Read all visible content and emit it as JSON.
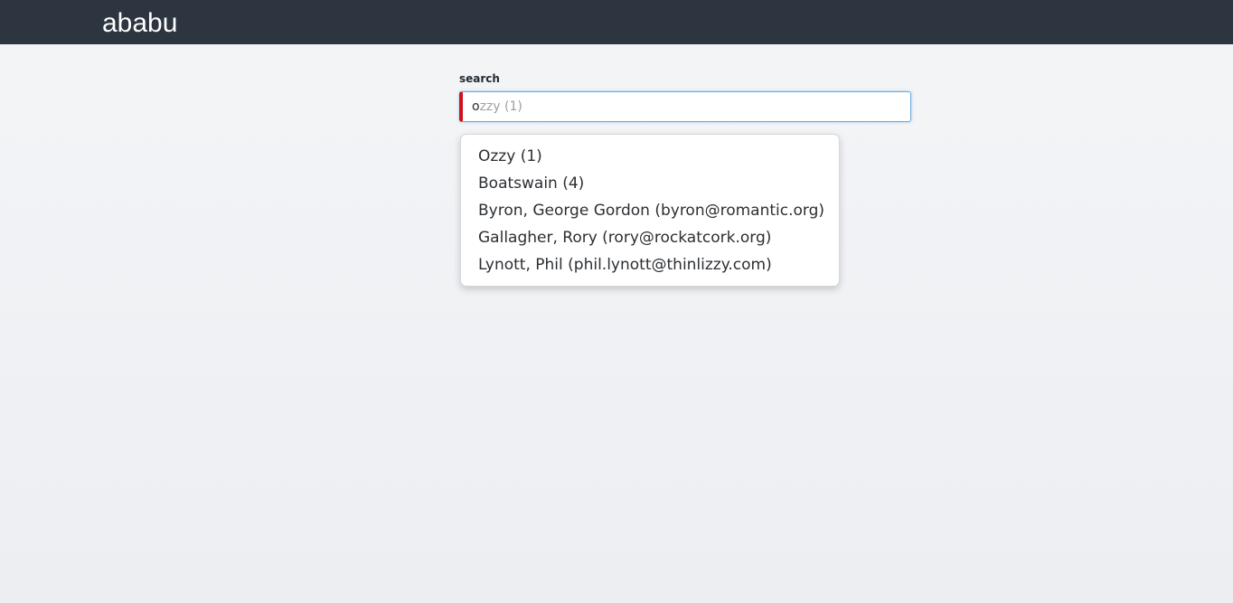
{
  "header": {
    "brand": "ababu"
  },
  "search": {
    "label": "search",
    "value": "o",
    "autocomplete_hint": "ozzy (1)"
  },
  "dropdown": {
    "items": [
      {
        "label": "Ozzy (1)"
      },
      {
        "label": "Boatswain (4)"
      },
      {
        "label": "Byron, George Gordon (byron@romantic.org)"
      },
      {
        "label": "Gallagher, Rory (rory@rockatcork.org)"
      },
      {
        "label": "Lynott, Phil (phil.lynott@thinlizzy.com)"
      }
    ]
  },
  "colors": {
    "header_bg": "#2c3540",
    "input_invalid_accent": "#d0111b",
    "input_focus_border": "#6aa9e0"
  }
}
